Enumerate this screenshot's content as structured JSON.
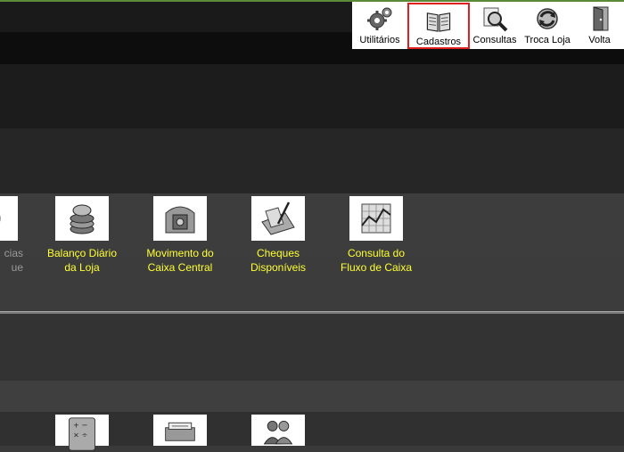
{
  "toolbar": {
    "items": [
      {
        "label": "Utilitários",
        "icon": "gears-icon"
      },
      {
        "label": "Cadastros",
        "icon": "book-icon",
        "selected": true
      },
      {
        "label": "Consultas",
        "icon": "magnifier-icon"
      },
      {
        "label": "Troca Loja",
        "icon": "refresh-icon"
      },
      {
        "label": "Volta",
        "icon": "exit-door-icon"
      }
    ],
    "highlight_color": "#e02020"
  },
  "section1": {
    "items": [
      {
        "label_line1": "cias",
        "label_line2": "ue",
        "icon": "coin-icon"
      },
      {
        "label_line1": "Balanço Diário",
        "label_line2": "da Loja",
        "icon": "coins-stack-icon"
      },
      {
        "label_line1": "Movimento do",
        "label_line2": "Caixa Central",
        "icon": "safe-icon"
      },
      {
        "label_line1": "Cheques",
        "label_line2": "Disponíveis",
        "icon": "cheque-pen-icon"
      },
      {
        "label_line1": "Consulta do",
        "label_line2": "Fluxo de Caixa",
        "icon": "chart-grid-icon"
      }
    ]
  },
  "section2": {
    "items": [
      {
        "icon": "calculator-icon"
      },
      {
        "icon": "cheque-printer-icon"
      },
      {
        "icon": "users-icon"
      }
    ]
  },
  "colors": {
    "label_text": "#ffff33",
    "background": "#3a3a3a"
  }
}
